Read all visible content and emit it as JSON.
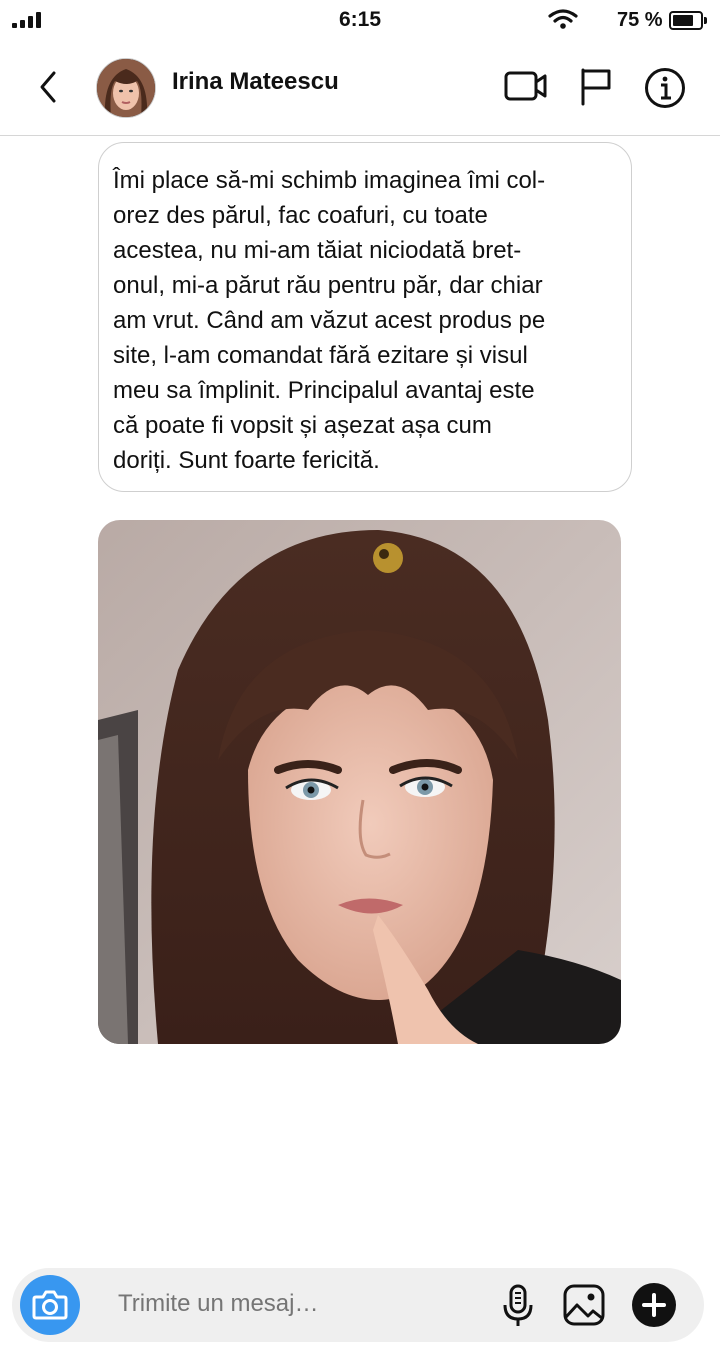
{
  "status_bar": {
    "time": "6:15",
    "battery_text": "75 %",
    "battery_level": 0.75
  },
  "header": {
    "contact_name": "Irina Mateescu",
    "icons": [
      "back-chevron-icon",
      "video-camera-icon",
      "flag-icon",
      "info-icon"
    ]
  },
  "message": {
    "text": "Îmi place să-mi schimb imaginea îmi col-\norez des părul, fac coafuri, cu toate\nacestea, nu mi-am tăiat niciodată bret-\nonul, mi-a părut rău pentru păr, dar chiar\nam vrut. Când am văzut acest produs pe\nsite, l-am comandat fără ezitare și visul\nmeu sa împlinit. Principalul avantaj este\ncă poate fi vopsit și așezat așa cum\ndoriți. Sunt foarte fericită."
  },
  "composer": {
    "placeholder": "Trimite un mesaj…",
    "icons": [
      "camera-icon",
      "microphone-icon",
      "gallery-icon",
      "plus-icon"
    ]
  },
  "colors": {
    "accent": "#3897f0",
    "composer_bg": "#efefef",
    "bubble_border": "#cfcfcf"
  }
}
